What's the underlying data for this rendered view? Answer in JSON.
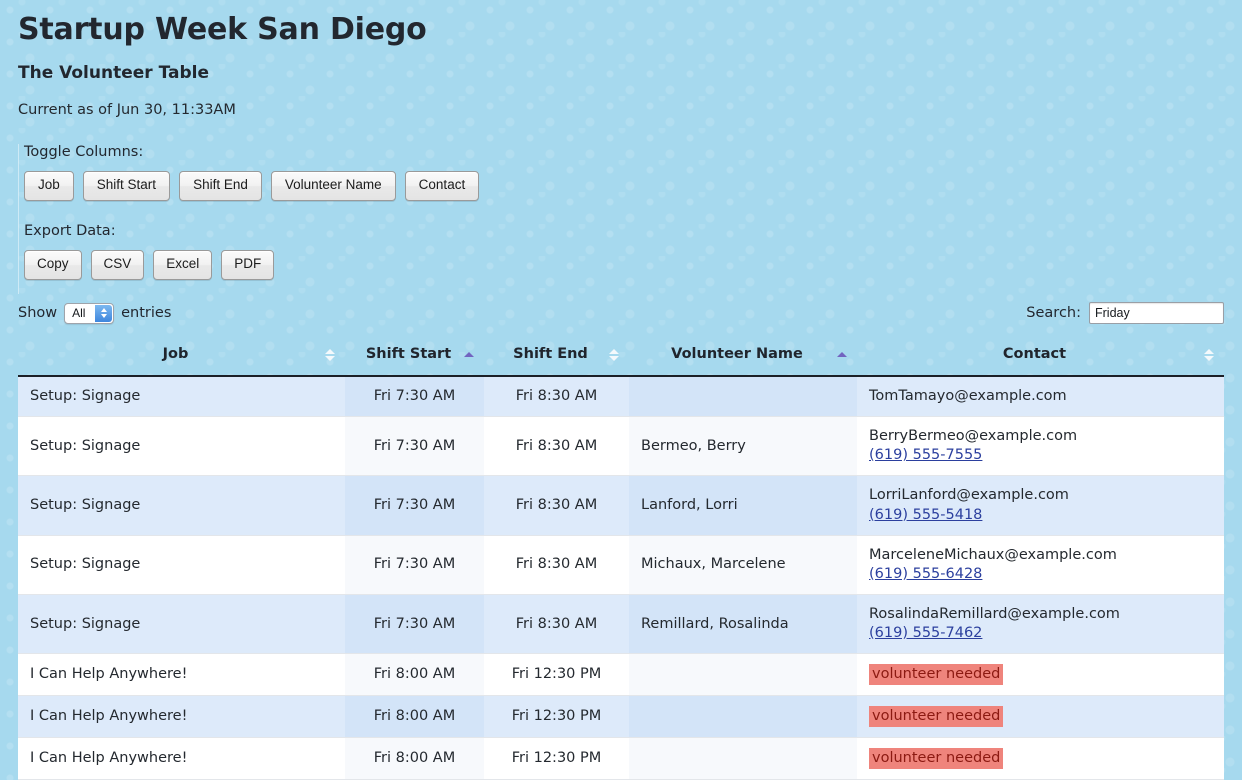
{
  "header": {
    "title": "Startup Week San Diego",
    "subtitle": "The Volunteer Table",
    "as_of": "Current as of Jun 30, 11:33AM"
  },
  "controls": {
    "toggle_columns_label": "Toggle Columns:",
    "toggle_buttons": [
      "Job",
      "Shift Start",
      "Shift End",
      "Volunteer Name",
      "Contact"
    ],
    "export_label": "Export Data:",
    "export_buttons": [
      "Copy",
      "CSV",
      "Excel",
      "PDF"
    ]
  },
  "tablebar": {
    "show_label": "Show",
    "entries_label": "entries",
    "page_length_value": "All",
    "search_label": "Search:",
    "search_value": "Friday"
  },
  "table": {
    "columns": [
      {
        "label": "Job",
        "sort": "none"
      },
      {
        "label": "Shift Start",
        "sort": "asc"
      },
      {
        "label": "Shift End",
        "sort": "none"
      },
      {
        "label": "Volunteer Name",
        "sort": "asc"
      },
      {
        "label": "Contact",
        "sort": "none"
      }
    ],
    "rows": [
      {
        "job": "Setup: Signage",
        "start": "Fri 7:30 AM",
        "end": "Fri 8:30 AM",
        "name": "",
        "email": "TomTamayo@example.com",
        "phone": ""
      },
      {
        "job": "Setup: Signage",
        "start": "Fri 7:30 AM",
        "end": "Fri 8:30 AM",
        "name": "Bermeo, Berry",
        "email": "BerryBermeo@example.com",
        "phone": "(619) 555-7555"
      },
      {
        "job": "Setup: Signage",
        "start": "Fri 7:30 AM",
        "end": "Fri 8:30 AM",
        "name": "Lanford, Lorri",
        "email": "LorriLanford@example.com",
        "phone": "(619) 555-5418"
      },
      {
        "job": "Setup: Signage",
        "start": "Fri 7:30 AM",
        "end": "Fri 8:30 AM",
        "name": "Michaux, Marcelene",
        "email": "MarceleneMichaux@example.com",
        "phone": "(619) 555-6428"
      },
      {
        "job": "Setup: Signage",
        "start": "Fri 7:30 AM",
        "end": "Fri 8:30 AM",
        "name": "Remillard, Rosalinda",
        "email": "RosalindaRemillard@example.com",
        "phone": "(619) 555-7462"
      },
      {
        "job": "I Can Help Anywhere!",
        "start": "Fri 8:00 AM",
        "end": "Fri 12:30 PM",
        "name": "",
        "email": "",
        "phone": "",
        "needed": "volunteer needed"
      },
      {
        "job": "I Can Help Anywhere!",
        "start": "Fri 8:00 AM",
        "end": "Fri 12:30 PM",
        "name": "",
        "email": "",
        "phone": "",
        "needed": "volunteer needed"
      },
      {
        "job": "I Can Help Anywhere!",
        "start": "Fri 8:00 AM",
        "end": "Fri 12:30 PM",
        "name": "",
        "email": "",
        "phone": "",
        "needed": "volunteer needed"
      }
    ]
  },
  "colors": {
    "page_background": "#a6d9ee",
    "row_stripe": "#ddeafa",
    "sorted_tint": "#d3e4f8",
    "needed_badge_bg": "#ef847c",
    "needed_badge_text": "#8c1a12",
    "sort_active": "#7264c0",
    "link": "#2b3f9e"
  }
}
